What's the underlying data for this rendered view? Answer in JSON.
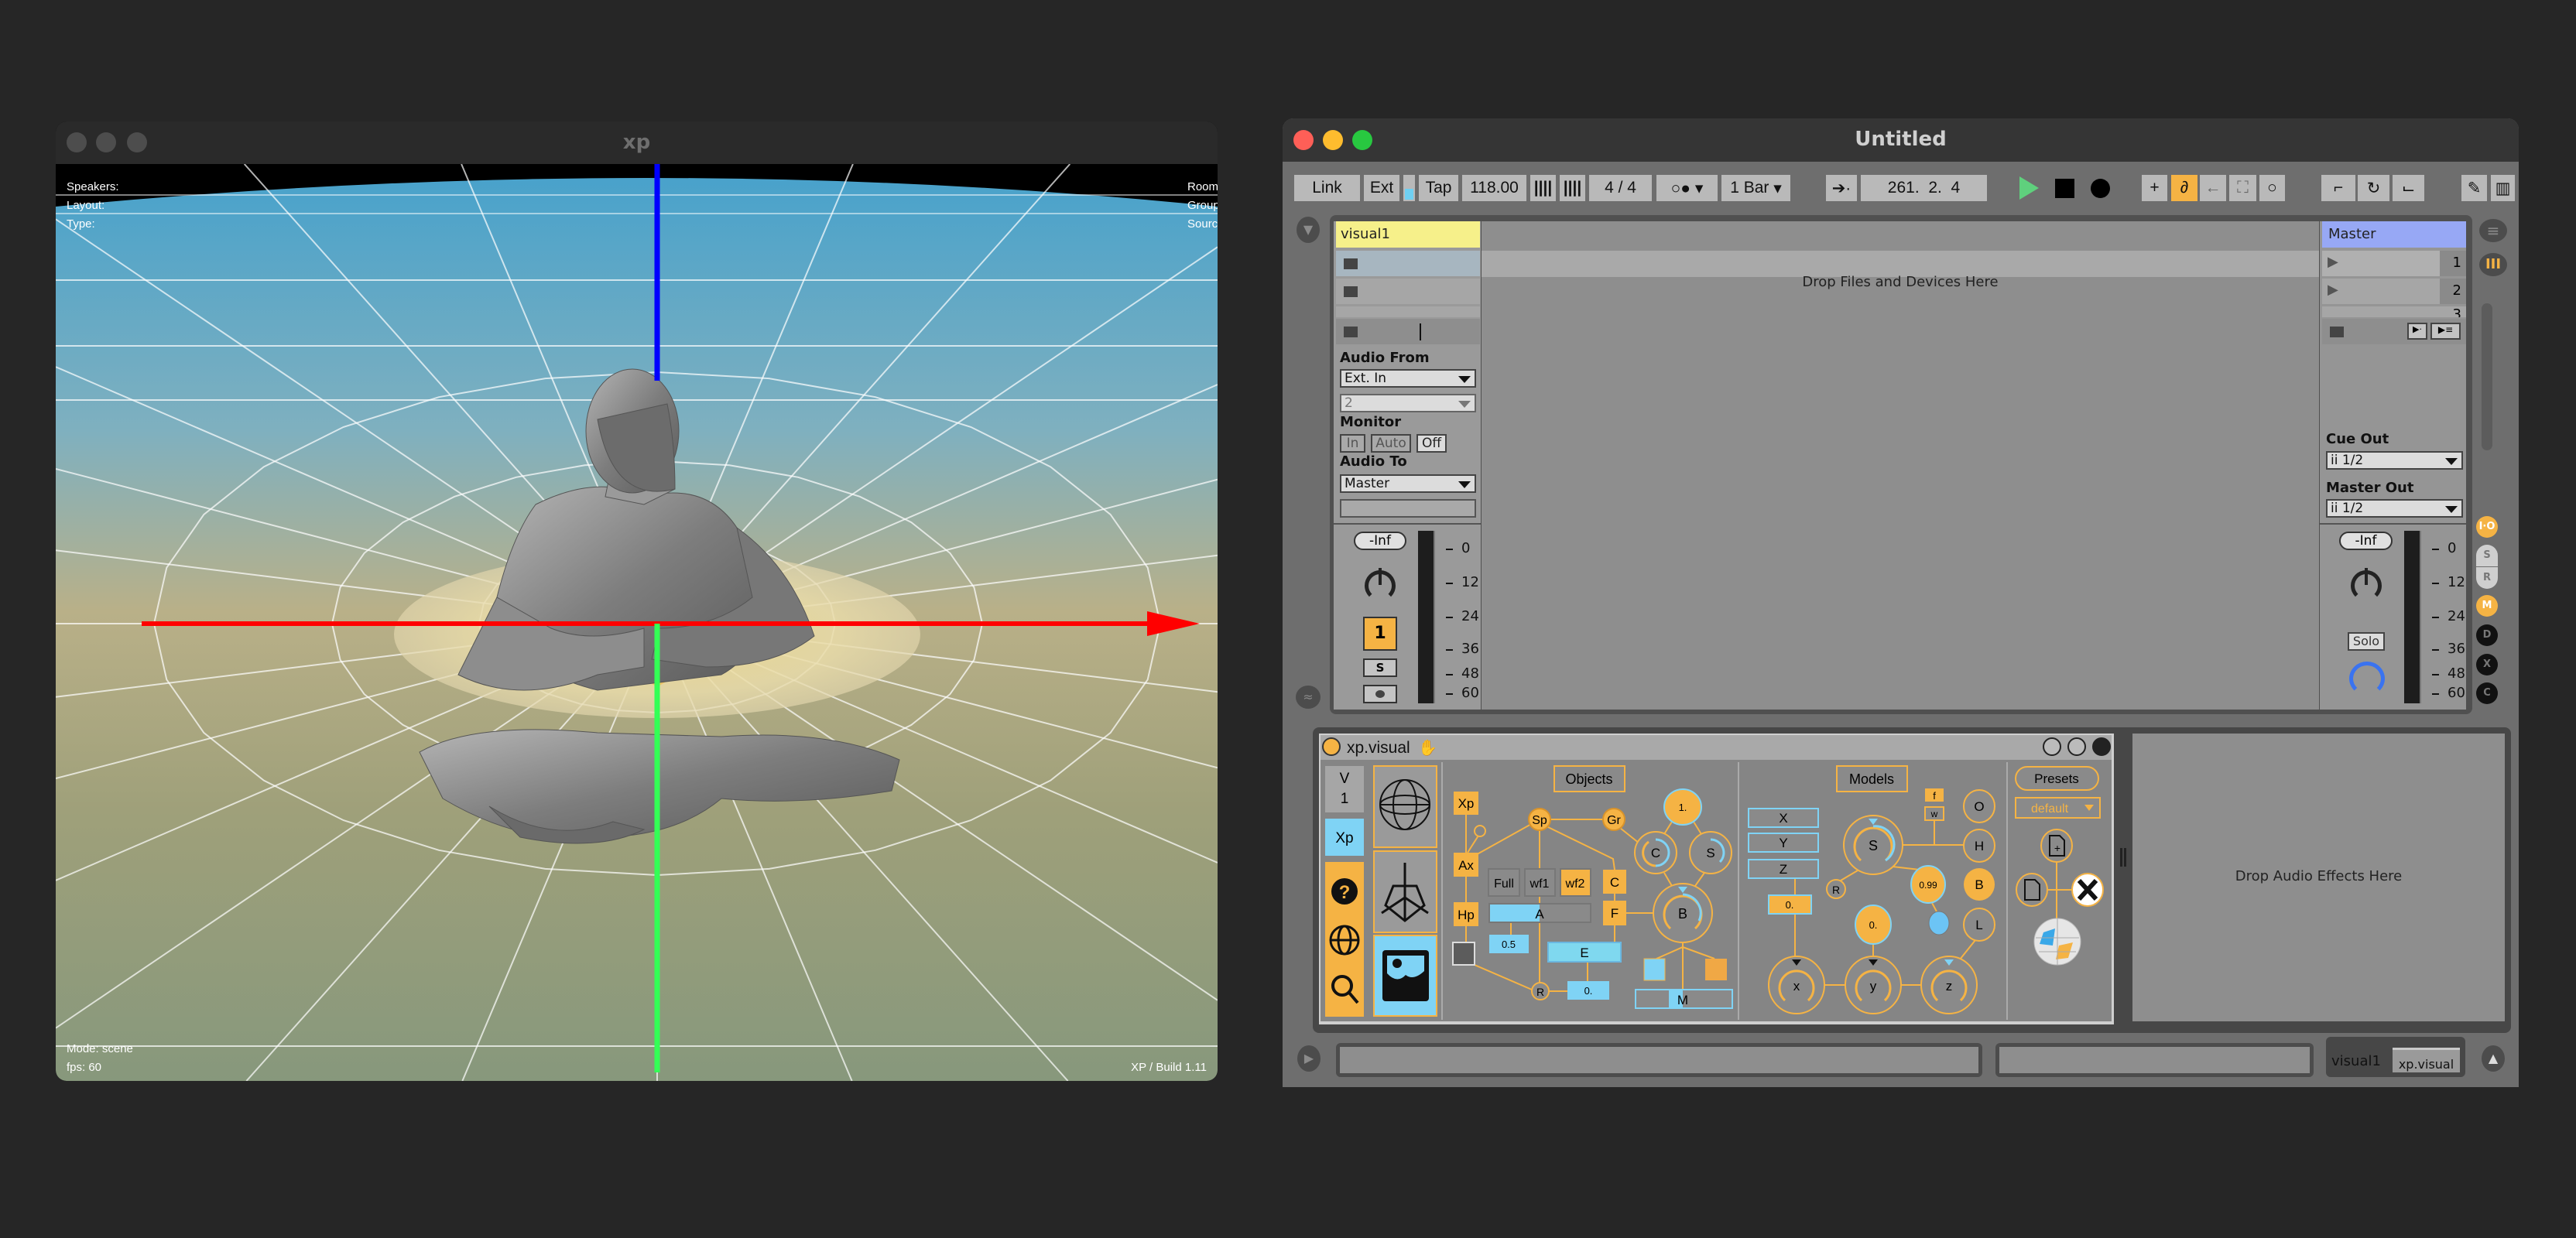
{
  "viewer_window": {
    "title": "xp",
    "hud": {
      "speakers": "Speakers:",
      "layout": "Layout:",
      "type": "Type:",
      "room": "Room:",
      "group": "Group:",
      "source": "Source:",
      "mode": "Mode: scene",
      "fps": "fps: 60",
      "build": "XP / Build 1.11"
    },
    "axis_colors": {
      "x": "#ff0000",
      "y": "#00ff40",
      "z": "#0000ff"
    }
  },
  "live_window": {
    "title": "Untitled",
    "transport": {
      "link": "Link",
      "ext": "Ext",
      "tap": "Tap",
      "tempo": "118.00",
      "time_signature": "4 / 4",
      "quantize": "1 Bar",
      "position": "261.  2.  4",
      "metronome_icon": "metronome-icon"
    },
    "session": {
      "drop_hint": "Drop Files and Devices Here",
      "track": {
        "name": "visual1",
        "color": "#f6f08a",
        "audio_from_label": "Audio From",
        "audio_from": "Ext. In",
        "input_channel": "2",
        "monitor_label": "Monitor",
        "monitor_options": [
          "In",
          "Auto",
          "Off"
        ],
        "monitor_selected": "Off",
        "audio_to_label": "Audio To",
        "audio_to": "Master",
        "volume": "-Inf",
        "track_number": "1",
        "solo": "S"
      },
      "master": {
        "name": "Master",
        "color": "#97a8f5",
        "scenes": [
          "1",
          "2",
          "3"
        ],
        "cue_out_label": "Cue Out",
        "cue_out": "1/2",
        "master_out_label": "Master Out",
        "master_out": "1/2",
        "volume": "-Inf",
        "solo": "Solo"
      },
      "meter_scale": [
        "0",
        "12",
        "24",
        "36",
        "48",
        "60"
      ],
      "side_buttons": [
        "I·O",
        "S",
        "R",
        "M",
        "D",
        "X",
        "C"
      ]
    },
    "device": {
      "name": "xp.visual",
      "version_label": "V",
      "version": "1",
      "xp_tab": "Xp",
      "objects": {
        "title": "Objects",
        "nodes": [
          "Xp",
          "Ax",
          "Hp",
          "Sp",
          "Gr",
          "C",
          "F",
          "C",
          "S",
          "B",
          "R"
        ],
        "modes": [
          "Full",
          "wf1",
          "wf2"
        ],
        "one_value": "1.",
        "a_label": "A",
        "a_value": "0.5",
        "e_label": "E",
        "r_value": "0.",
        "m_label": "M"
      },
      "models": {
        "title": "Models",
        "axes": [
          "X",
          "Y",
          "Z"
        ],
        "z_value": "0.",
        "nodes": [
          "S",
          "R",
          "O",
          "H",
          "B",
          "L",
          "f",
          "w"
        ],
        "s_value": "0.99",
        "y_value": "0.",
        "dials": [
          "x",
          "y",
          "z"
        ]
      },
      "presets": {
        "title": "Presets",
        "selected": "default"
      },
      "accent": "#f5b344",
      "cyan": "#7fd3f5"
    },
    "drop_effects_hint": "Drop Audio Effects Here",
    "footer": {
      "track": "visual1",
      "device_chip": "xp.visual"
    }
  }
}
